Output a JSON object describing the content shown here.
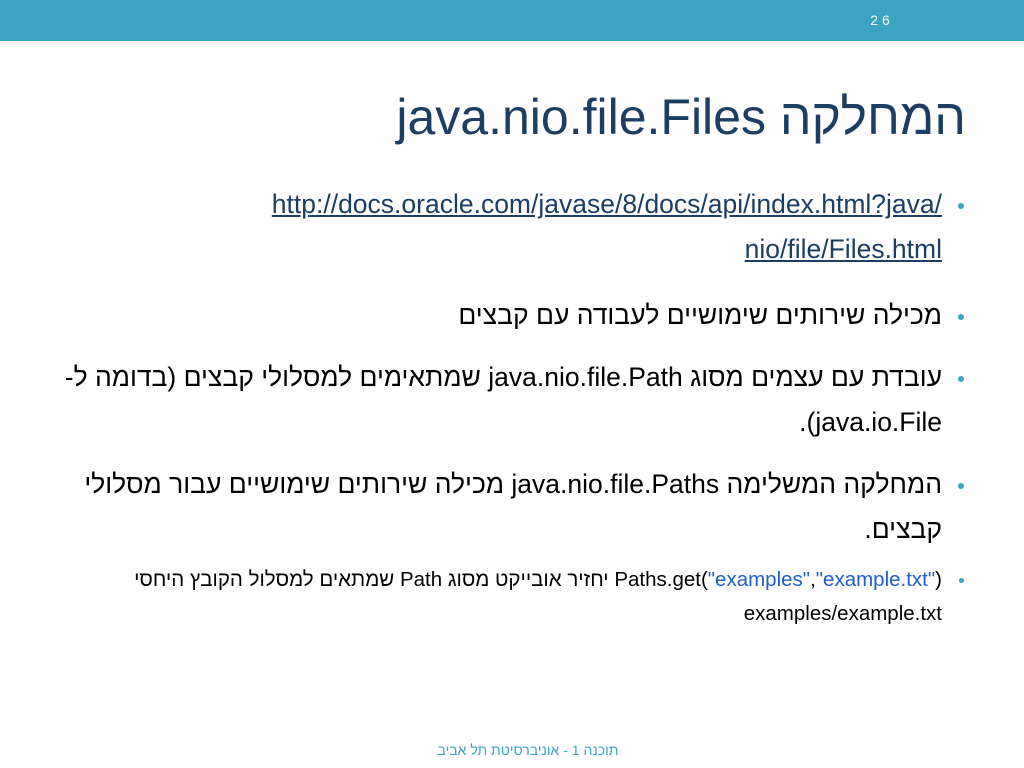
{
  "slide": {
    "number": "2 6",
    "title": "המחלקה java.nio.file.Files",
    "footer": "תוכנה 1 - אוניברסיטת תל אביב"
  },
  "bullets": {
    "link": {
      "line1": "http://docs.oracle.com/javase/8/docs/api/index.html?java/",
      "line2": "nio/file/Files.html"
    },
    "utilities": "מכילה שירותים שימושיים לעבודה עם קבצים",
    "path_objects": "עובדת עם עצמים מסוג java.nio.file.Path שמתאימים למסלולי קבצים (בדומה ל-java.io.File).",
    "paths_class": "המחלקה המשלימה java.nio.file.Paths מכילה שירותים שימושיים עבור מסלולי קבצים.",
    "example": {
      "code_start": "Paths.get(",
      "arg1": "\"examples\"",
      "comma": ",",
      "arg2": "\"example.txt\"",
      "code_end": ")",
      "text1": " יחזיר אובייקט מסוג Path שמתאים למסלול הקובץ היחסי  ",
      "relative_path": "examples/example.txt"
    }
  }
}
